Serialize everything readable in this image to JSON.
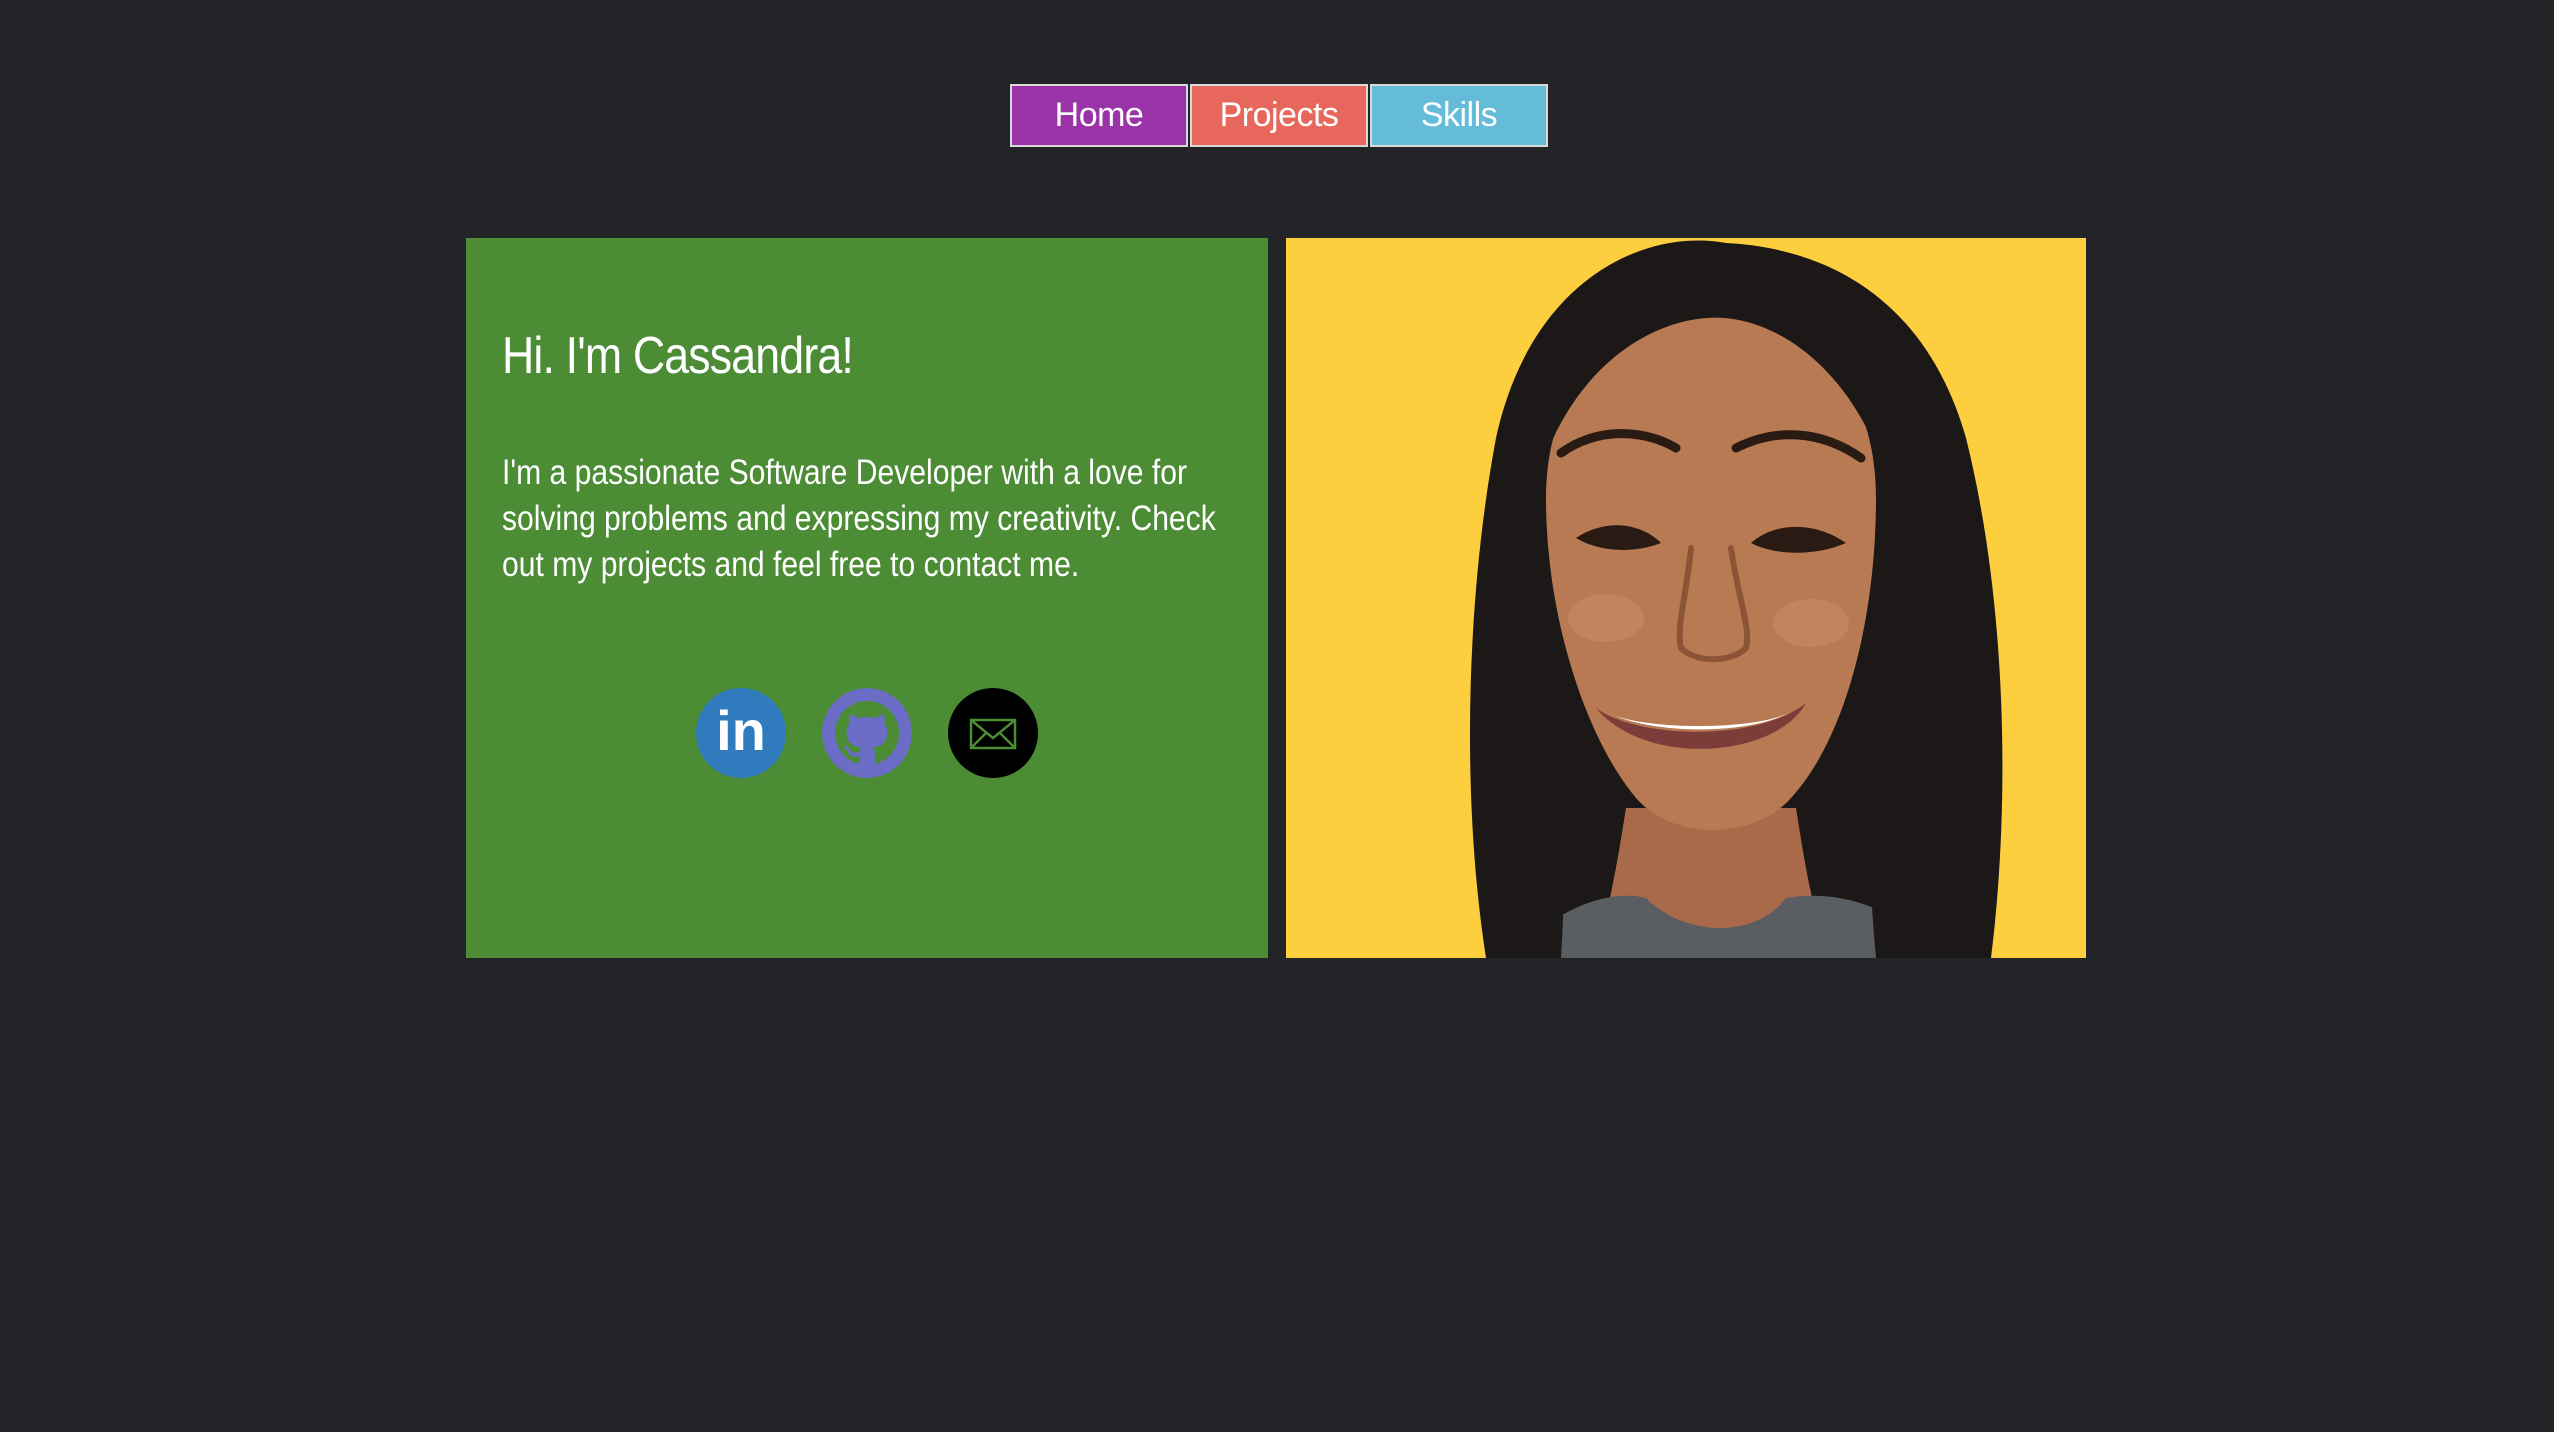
{
  "nav": {
    "home": "Home",
    "projects": "Projects",
    "skills": "Skills"
  },
  "intro": {
    "title": "Hi. I'm Cassandra!",
    "text": "I'm a passionate Software Developer with a love for solving problems and expressing my creativity. Check out my projects and feel free to contact me."
  },
  "social": {
    "linkedin_label": "in",
    "icons": [
      "linkedin-icon",
      "github-icon",
      "email-icon"
    ]
  },
  "colors": {
    "background": "#232427",
    "home": "#9b33a8",
    "projects": "#e8675c",
    "skills": "#64bcd9",
    "intro_card": "#4b8c35",
    "photo_background": "#fdce3e",
    "linkedin": "#2f7bbd",
    "github": "#6a6cc6"
  }
}
